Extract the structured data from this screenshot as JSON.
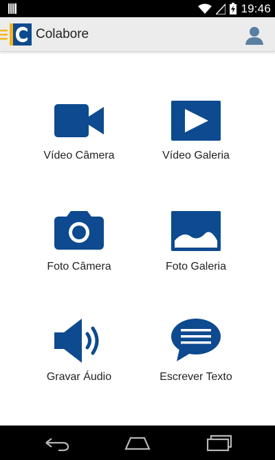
{
  "status_bar": {
    "time": "19:46",
    "icons": [
      "notification-icon",
      "wifi-icon",
      "cellular-signal-icon",
      "battery-charging-icon"
    ]
  },
  "app_bar": {
    "title": "Colabore",
    "icons": [
      "menu-icon",
      "colabore-logo-icon",
      "profile-icon"
    ]
  },
  "tiles": [
    {
      "label": "Vídeo Câmera",
      "icon": "video-camera-icon"
    },
    {
      "label": "Vídeo Galeria",
      "icon": "video-gallery-play-icon"
    },
    {
      "label": "Foto Câmera",
      "icon": "photo-camera-icon"
    },
    {
      "label": "Foto Galeria",
      "icon": "photo-gallery-image-icon"
    },
    {
      "label": "Gravar Áudio",
      "icon": "audio-speaker-icon"
    },
    {
      "label": "Escrever Texto",
      "icon": "text-chat-bubble-icon"
    }
  ],
  "nav_bar": {
    "icons": [
      "back-icon",
      "home-icon",
      "recent-apps-icon"
    ]
  },
  "colors": {
    "primary_icon": "#0d4a8f",
    "logo_yellow": "#f5b41a",
    "logo_blue": "#0d4a8f",
    "app_bar_bg": "#ececec",
    "label_text": "#222222"
  }
}
